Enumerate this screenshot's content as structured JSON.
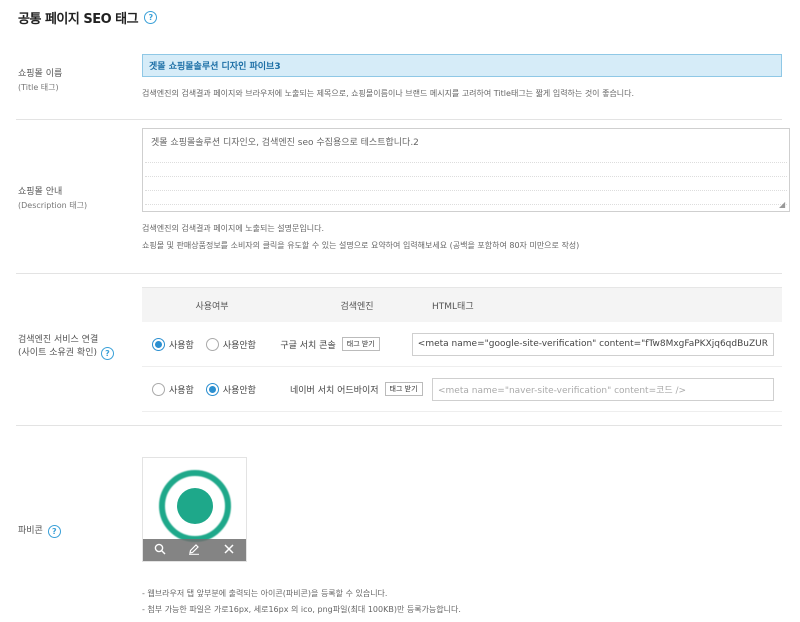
{
  "header": {
    "title": "공통 페이지 SEO 태그",
    "help": "?"
  },
  "shop_name": {
    "label": "쇼핑몰 이름",
    "sub_label": "(Title 태그)",
    "value": "겟몰 쇼핑몰솔루션 디자인 파이브3",
    "help": "검색엔진의 검색결과 페이지와 브라우저에 노출되는 제목으로, 쇼핑몰이름이나 브랜드 메시지를 고려하여 Title태그는 짧게 입력하는 것이 좋습니다."
  },
  "shop_desc": {
    "label": "쇼핑몰 안내",
    "sub_label": "(Description 태그)",
    "value": "겟몰 쇼핑몰솔루션 디자인오, 검색엔진 seo 수집용으로 테스트합니다.2",
    "help1": "검색엔진의 검색결과 페이지에 노출되는 설명문입니다.",
    "help2": "쇼핑몰 및 판매상품정보를 소비자의 클릭을 유도할 수 있는 설명으로 요약하여 입력해보세요 (공백을 포함하여 80자 미만으로 작성)"
  },
  "search_service": {
    "label": "검색엔진 서비스 연결",
    "sub_label": "(사이트 소유권 확인)",
    "help": "?",
    "columns": [
      "사용여부",
      "검색엔진",
      "HTML태그"
    ],
    "rows": [
      {
        "use": "사용함",
        "nouse": "사용안함",
        "selected": "use",
        "engine": "구글 서치 콘솔",
        "button": "태그 받기",
        "tag": "<meta name=\"google-site-verification\" content=\"fTw8MxgFaPKXjq6qdBuZUR",
        "placeholder": false
      },
      {
        "use": "사용함",
        "nouse": "사용안함",
        "selected": "nouse",
        "engine": "네이버 서치 어드바이저",
        "button": "태그 받기",
        "tag": "<meta name=\"naver-site-verification\" content=코드 />",
        "placeholder": true
      }
    ]
  },
  "favicon": {
    "label": "파비콘",
    "help": "?",
    "icon_color": "#1ea88a",
    "note1": "- 웹브라우저 탭 앞부분에 출력되는 아이콘(파비콘)을 등록할 수 있습니다.",
    "note2": "- 첨부 가능한 파일은 가로16px, 세로16px 의 ico, png파일(최대 100KB)만 등록가능합니다."
  },
  "colors": {
    "accent": "#2b8fd0",
    "title_bg": "#d6ecf8"
  }
}
